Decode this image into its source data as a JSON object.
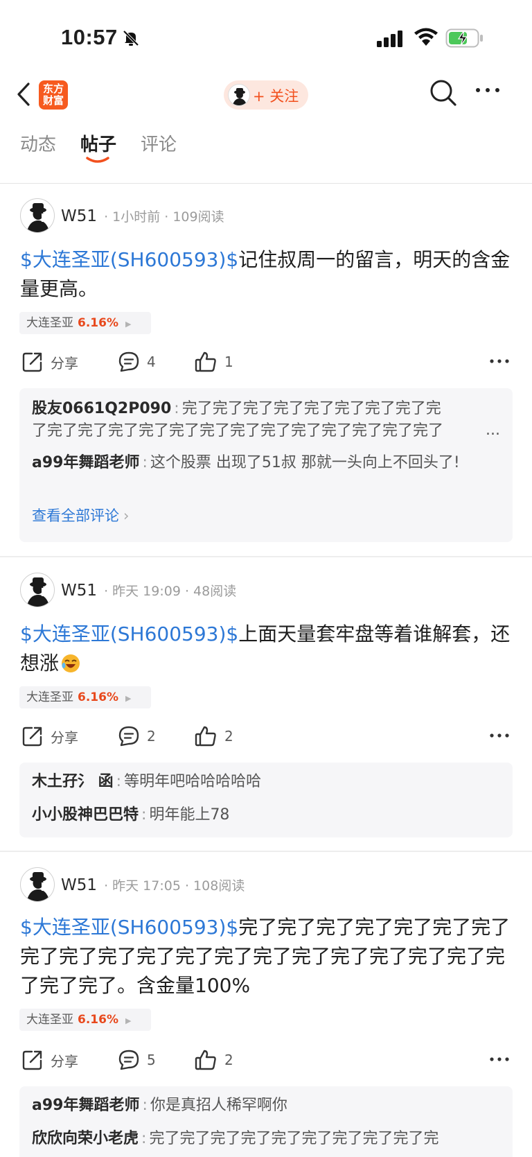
{
  "status": {
    "time": "10:57"
  },
  "nav": {
    "logo_line1": "东方",
    "logo_line2": "财富",
    "follow_label": "+ 关注"
  },
  "tabs": [
    {
      "label": "动态"
    },
    {
      "label": "帖子"
    },
    {
      "label": "评论"
    }
  ],
  "posts": [
    {
      "author": "W51",
      "meta": "· 1小时前 · 109阅读",
      "stock_link": "$大连圣亚(SH600593)$",
      "text": "记住叔周一的留言，明天的含金量更高。",
      "tag_name": "大连圣亚",
      "tag_pct": "6.16%",
      "share_label": "分享",
      "comment_count": "4",
      "like_count": "1",
      "comments": [
        {
          "user": "股友0661Q2P090",
          "text": "完了完了完了完了完了完了完了完了完了完了完了完了完了完了完了完了完了完了完了完了完了完了"
        },
        {
          "user": "a99年舞蹈老师",
          "text": "这个股票 出现了51叔 那就一头向上不回头了!"
        }
      ],
      "view_all": "查看全部评论",
      "ellipsis": "..."
    },
    {
      "author": "W51",
      "meta": "· 昨天 19:09 · 48阅读",
      "stock_link": "$大连圣亚(SH600593)$",
      "text": "上面天量套牢盘等着谁解套，还想涨",
      "tag_name": "大连圣亚",
      "tag_pct": "6.16%",
      "share_label": "分享",
      "comment_count": "2",
      "like_count": "2",
      "comments": [
        {
          "user": "木土孖氵 函",
          "text": "等明年吧哈哈哈哈哈"
        },
        {
          "user": "小小股神巴巴特",
          "text": "明年能上78"
        }
      ]
    },
    {
      "author": "W51",
      "meta": "· 昨天 17:05 · 108阅读",
      "stock_link": "$大连圣亚(SH600593)$",
      "text": "完了完了完了完了完了完了完了完了完了完了完了完了完了完了完了完了完了完了完了完了完了完了。含金量100%",
      "tag_name": "大连圣亚",
      "tag_pct": "6.16%",
      "share_label": "分享",
      "comment_count": "5",
      "like_count": "2",
      "comments": [
        {
          "user": "a99年舞蹈老师",
          "text": "你是真招人稀罕啊你"
        },
        {
          "user": "欣欣向荣小老虎",
          "text": "完了完了完了完了完了完了完了完了完了完"
        }
      ]
    }
  ]
}
